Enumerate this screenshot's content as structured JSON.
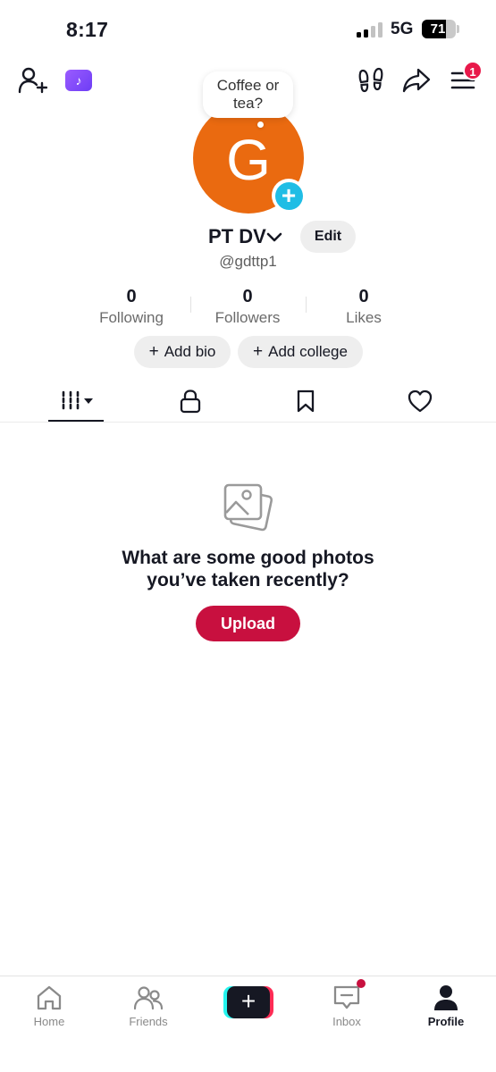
{
  "status_bar": {
    "time": "8:17",
    "network": "5G",
    "battery": "71",
    "signal_bars_active": 2,
    "signal_bars_total": 4
  },
  "top_nav": {
    "menu_badge": "1",
    "icons": [
      "add-friend-icon",
      "tiktok-promo-icon",
      "footprints-icon",
      "share-icon",
      "menu-icon"
    ],
    "promo_glyph": "♪"
  },
  "profile": {
    "note": "Coffee or tea?",
    "avatar_letter": "G",
    "avatar_color": "#ea6a10",
    "display_name": "PT DV",
    "edit_label": "Edit",
    "username": "@gdttp1",
    "stats": [
      {
        "value": "0",
        "label": "Following"
      },
      {
        "value": "0",
        "label": "Followers"
      },
      {
        "value": "0",
        "label": "Likes"
      }
    ],
    "add_bio_label": "Add bio",
    "add_college_label": "Add college"
  },
  "tabs": {
    "active": "grid",
    "items": [
      "grid-icon",
      "lock-icon",
      "bookmark-icon",
      "heart-icon"
    ]
  },
  "empty_state": {
    "title": "What are some good photos you’ve taken recently?",
    "upload_label": "Upload"
  },
  "bottom_nav": {
    "items": [
      {
        "label": "Home",
        "icon": "home-icon"
      },
      {
        "label": "Friends",
        "icon": "friends-icon"
      },
      {
        "label": "",
        "icon": "plus-icon"
      },
      {
        "label": "Inbox",
        "icon": "inbox-icon"
      },
      {
        "label": "Profile",
        "icon": "profile-icon"
      }
    ],
    "create_glyph": "+",
    "active": "Profile"
  },
  "colors": {
    "accent": "#c8103f",
    "badge": "#e8194a",
    "avatar_plus": "#20bde5"
  }
}
